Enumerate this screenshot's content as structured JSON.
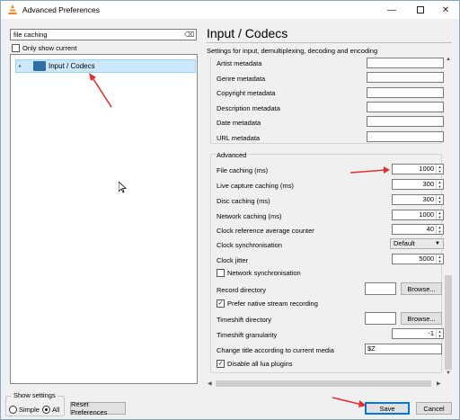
{
  "window": {
    "title": "Advanced Preferences"
  },
  "search": {
    "value": "file caching"
  },
  "only_show_current": {
    "label": "Only show current",
    "checked": false
  },
  "tree": {
    "items": [
      {
        "label": "Input / Codecs",
        "selected": true
      }
    ]
  },
  "show_settings": {
    "title": "Show settings",
    "options": [
      {
        "label": "Simple",
        "selected": false
      },
      {
        "label": "All",
        "selected": true
      }
    ]
  },
  "buttons": {
    "reset": "Reset Preferences",
    "save": "Save",
    "cancel": "Cancel"
  },
  "panel": {
    "title": "Input / Codecs",
    "subtitle": "Settings for input, demultiplexing, decoding and encoding",
    "metadata": [
      {
        "label": "Artist metadata",
        "value": ""
      },
      {
        "label": "Genre metadata",
        "value": ""
      },
      {
        "label": "Copyright metadata",
        "value": ""
      },
      {
        "label": "Description metadata",
        "value": ""
      },
      {
        "label": "Date metadata",
        "value": ""
      },
      {
        "label": "URL metadata",
        "value": ""
      }
    ],
    "advanced_title": "Advanced",
    "advanced": {
      "file_caching": {
        "label": "File caching (ms)",
        "value": "1000"
      },
      "live_capture_caching": {
        "label": "Live capture caching (ms)",
        "value": "300"
      },
      "disc_caching": {
        "label": "Disc caching (ms)",
        "value": "300"
      },
      "network_caching": {
        "label": "Network caching (ms)",
        "value": "1000"
      },
      "clock_ref_counter": {
        "label": "Clock reference average counter",
        "value": "40"
      },
      "clock_sync": {
        "label": "Clock synchronisation",
        "value": "Default"
      },
      "clock_jitter": {
        "label": "Clock jitter",
        "value": "5000"
      },
      "network_sync": {
        "label": "Network synchronisation",
        "checked": false
      },
      "record_directory": {
        "label": "Record directory",
        "value": "",
        "button": "Browse..."
      },
      "prefer_native": {
        "label": "Prefer native stream recording",
        "checked": true
      },
      "timeshift_directory": {
        "label": "Timeshift directory",
        "value": "",
        "button": "Browse..."
      },
      "timeshift_granularity": {
        "label": "Timeshift granularity",
        "value": "-1"
      },
      "change_title": {
        "label": "Change title according to current media",
        "value": "$Z"
      },
      "disable_lua": {
        "label": "Disable all lua plugins",
        "checked": true
      }
    }
  },
  "colors": {
    "annotation_red": "#e03030",
    "selection": "#cce8ff",
    "accent": "#0078d7"
  }
}
